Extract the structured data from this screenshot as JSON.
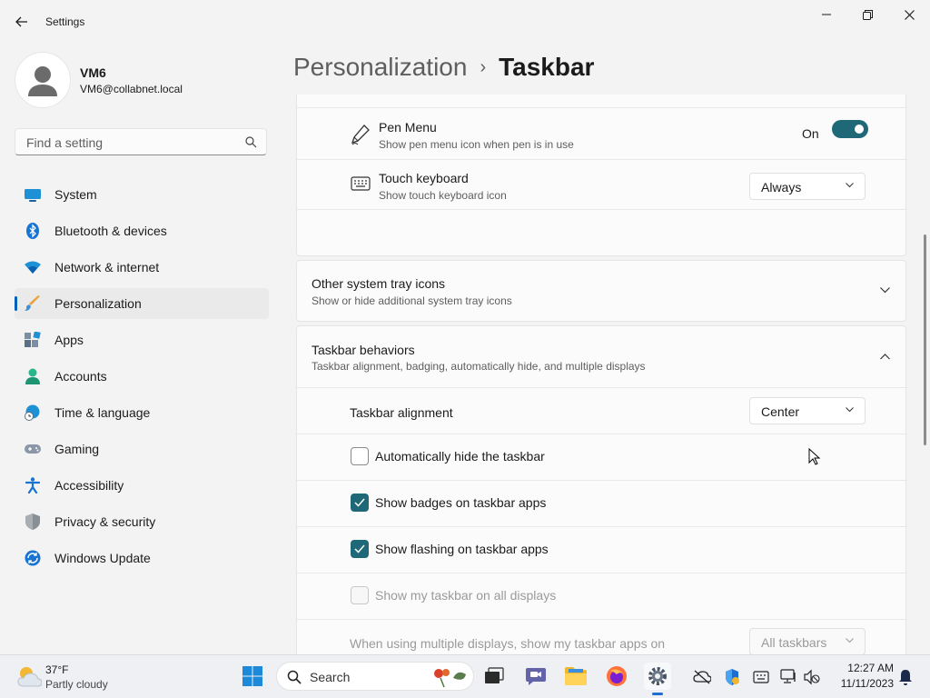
{
  "app": {
    "title": "Settings"
  },
  "profile": {
    "name": "VM6",
    "email": "VM6@collabnet.local"
  },
  "search": {
    "placeholder": "Find a setting"
  },
  "sidebar": {
    "items": [
      {
        "label": "System",
        "icon": "monitor-icon"
      },
      {
        "label": "Bluetooth & devices",
        "icon": "bluetooth-icon"
      },
      {
        "label": "Network & internet",
        "icon": "wifi-icon"
      },
      {
        "label": "Personalization",
        "icon": "brush-icon",
        "selected": true
      },
      {
        "label": "Apps",
        "icon": "apps-icon"
      },
      {
        "label": "Accounts",
        "icon": "accounts-icon"
      },
      {
        "label": "Time & language",
        "icon": "globe-clock-icon"
      },
      {
        "label": "Gaming",
        "icon": "gamepad-icon"
      },
      {
        "label": "Accessibility",
        "icon": "accessibility-icon"
      },
      {
        "label": "Privacy & security",
        "icon": "shield-icon"
      },
      {
        "label": "Windows Update",
        "icon": "update-icon"
      }
    ]
  },
  "header": {
    "parent": "Personalization",
    "separator": "›",
    "current": "Taskbar"
  },
  "tray_section": {
    "pen_menu": {
      "title": "Pen Menu",
      "subtitle": "Show pen menu icon when pen is in use",
      "state_label": "On",
      "enabled": true
    },
    "touch_keyboard": {
      "title": "Touch keyboard",
      "subtitle": "Show touch keyboard icon",
      "value": "Always"
    }
  },
  "other_tray": {
    "title": "Other system tray icons",
    "subtitle": "Show or hide additional system tray icons"
  },
  "behaviors": {
    "title": "Taskbar behaviors",
    "subtitle": "Taskbar alignment, badging, automatically hide, and multiple displays",
    "alignment": {
      "label": "Taskbar alignment",
      "value": "Center"
    },
    "checkboxes": [
      {
        "label": "Automatically hide the taskbar",
        "checked": false,
        "disabled": false
      },
      {
        "label": "Show badges on taskbar apps",
        "checked": true,
        "disabled": false
      },
      {
        "label": "Show flashing on taskbar apps",
        "checked": true,
        "disabled": false
      },
      {
        "label": "Show my taskbar on all displays",
        "checked": false,
        "disabled": true
      }
    ],
    "multi_display": {
      "label": "When using multiple displays, show my taskbar apps on",
      "value": "All taskbars",
      "disabled": true
    }
  },
  "taskbar": {
    "weather": {
      "temp": "37°F",
      "condition": "Partly cloudy"
    },
    "search_label": "Search",
    "clock": {
      "time": "12:27 AM",
      "date": "11/11/2023"
    }
  },
  "colors": {
    "accent": "#1f6877",
    "nav_indicator": "#005fb8",
    "background": "#f3f3f3",
    "card": "#fbfbfb"
  }
}
